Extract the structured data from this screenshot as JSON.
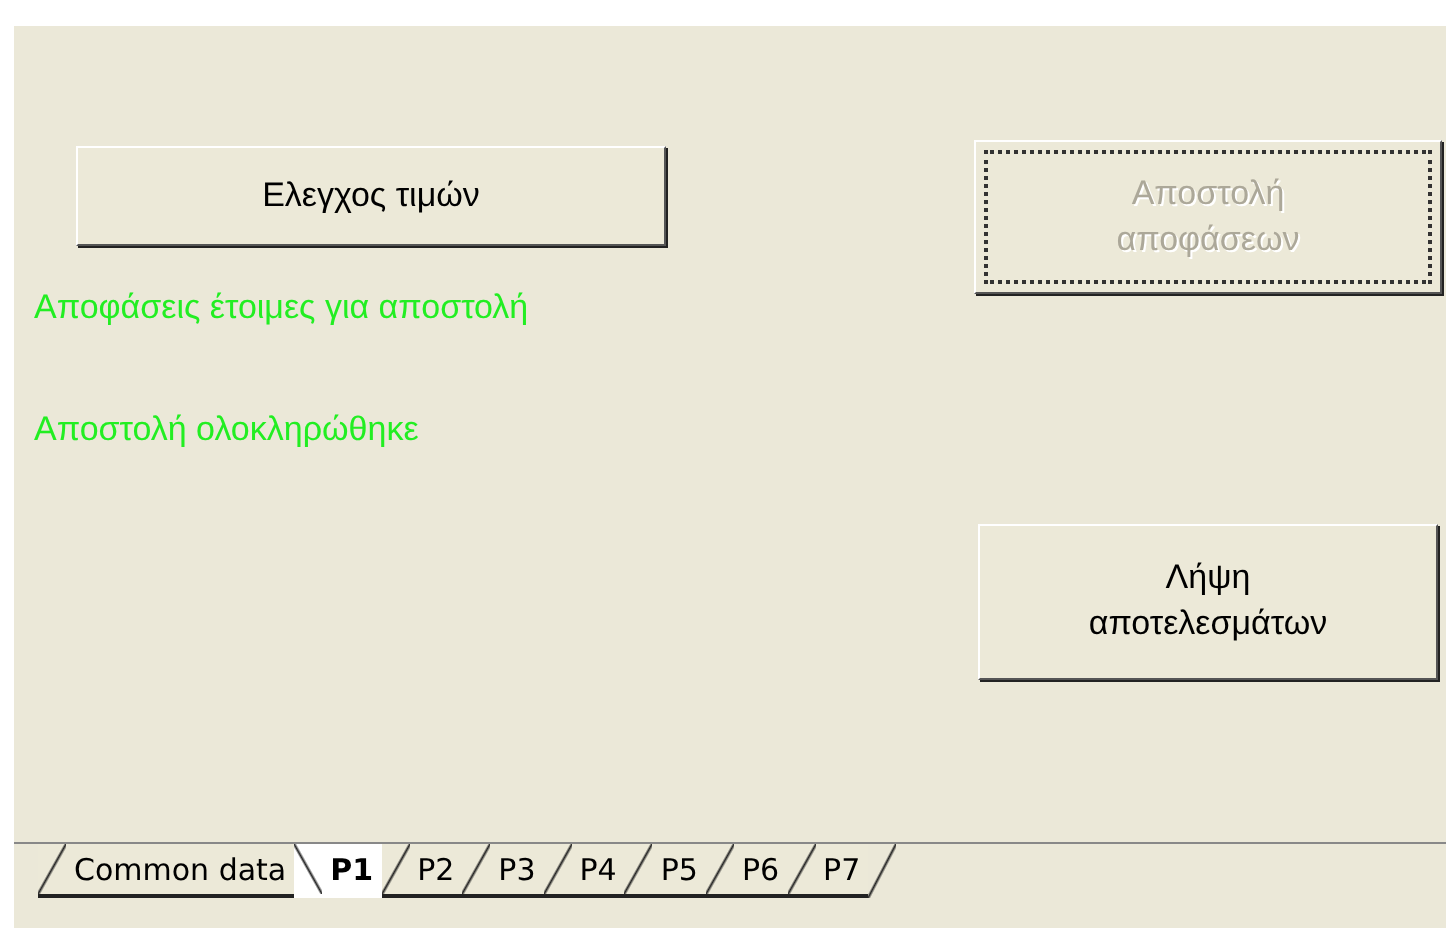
{
  "buttons": [
    {
      "label": "Ελεγχος τιμών",
      "disabled": false
    },
    {
      "label": "Αποστολή αποφάσεων",
      "disabled": true
    },
    {
      "label": "Λήψη αποτελεσμάτων",
      "disabled": false
    }
  ],
  "messages": [
    "Αποφάσεις έτοιμες για αποστολή",
    "Αποστολή ολοκληρώθηκε"
  ],
  "sheet_tabs": [
    {
      "label": "Common data",
      "selected": false
    },
    {
      "label": "P1",
      "selected": true
    },
    {
      "label": "P2",
      "selected": false
    },
    {
      "label": "P3",
      "selected": false
    },
    {
      "label": "P4",
      "selected": false
    },
    {
      "label": "P5",
      "selected": false
    },
    {
      "label": "P6",
      "selected": false
    },
    {
      "label": "P7",
      "selected": false
    }
  ]
}
